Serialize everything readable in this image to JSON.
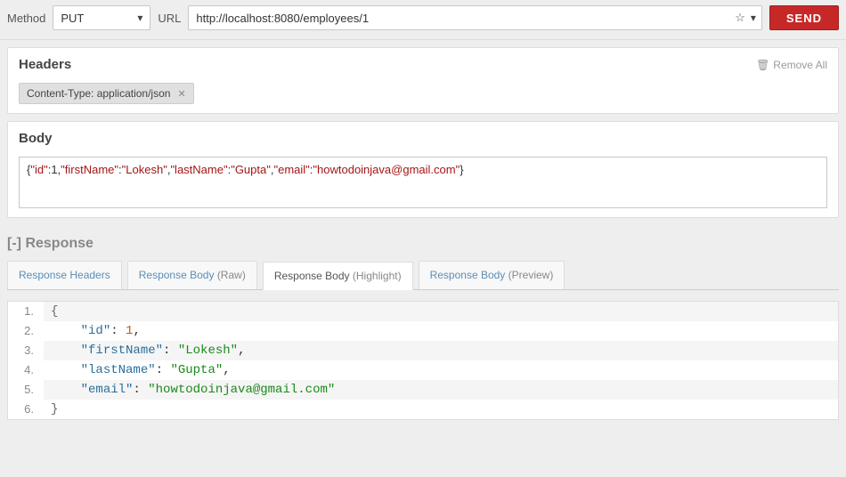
{
  "topbar": {
    "method_label": "Method",
    "method_value": "PUT",
    "url_label": "URL",
    "url_value": "http://localhost:8080/employees/1",
    "send_label": "SEND"
  },
  "headers_panel": {
    "title": "Headers",
    "remove_all": "Remove All",
    "chips": [
      {
        "text": "Content-Type: application/json"
      }
    ]
  },
  "body_panel": {
    "title": "Body",
    "content": "{\"id\":1,\"firstName\":\"Lokesh\",\"lastName\":\"Gupta\",\"email\":\"howtodoinjava@gmail.com\"}"
  },
  "response": {
    "collapse_prefix": "[-]",
    "title": "Response",
    "tabs": [
      {
        "label": "Response Headers",
        "active": false
      },
      {
        "label": "Response Body",
        "suffix": "(Raw)",
        "active": false
      },
      {
        "label": "Response Body",
        "suffix": "(Highlight)",
        "active": true
      },
      {
        "label": "Response Body",
        "suffix": "(Preview)",
        "active": false
      }
    ],
    "code_lines": [
      [
        {
          "t": "brace",
          "v": "{"
        }
      ],
      [
        {
          "t": "indent",
          "v": "    "
        },
        {
          "t": "key",
          "v": "\"id\""
        },
        {
          "t": "punc",
          "v": ": "
        },
        {
          "t": "num",
          "v": "1"
        },
        {
          "t": "punc",
          "v": ","
        }
      ],
      [
        {
          "t": "indent",
          "v": "    "
        },
        {
          "t": "key",
          "v": "\"firstName\""
        },
        {
          "t": "punc",
          "v": ": "
        },
        {
          "t": "str",
          "v": "\"Lokesh\""
        },
        {
          "t": "punc",
          "v": ","
        }
      ],
      [
        {
          "t": "indent",
          "v": "    "
        },
        {
          "t": "key",
          "v": "\"lastName\""
        },
        {
          "t": "punc",
          "v": ": "
        },
        {
          "t": "str",
          "v": "\"Gupta\""
        },
        {
          "t": "punc",
          "v": ","
        }
      ],
      [
        {
          "t": "indent",
          "v": "    "
        },
        {
          "t": "key",
          "v": "\"email\""
        },
        {
          "t": "punc",
          "v": ": "
        },
        {
          "t": "str",
          "v": "\"howtodoinjava@gmail.com\""
        }
      ],
      [
        {
          "t": "brace",
          "v": "}"
        }
      ]
    ]
  }
}
